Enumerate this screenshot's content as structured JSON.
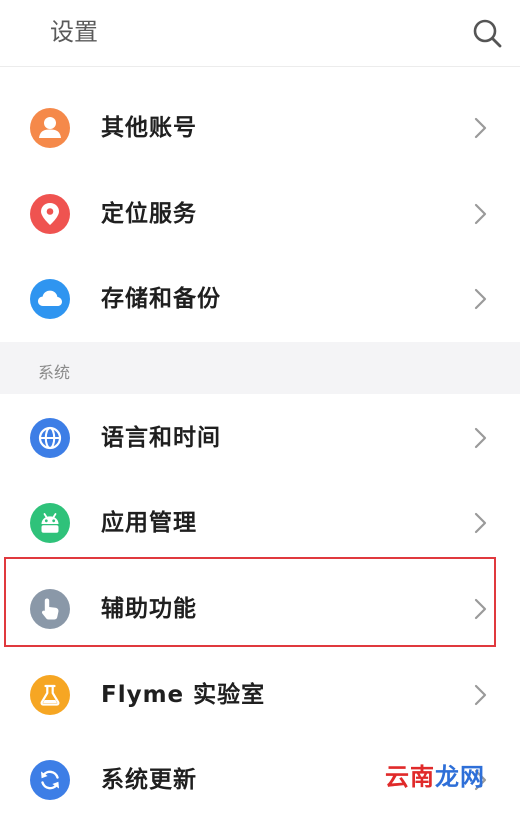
{
  "header": {
    "title": "设置",
    "search_icon": "search-icon"
  },
  "rows_top": [
    {
      "label": "其他账号",
      "icon": "person-icon",
      "color": "#f5894a"
    },
    {
      "label": "定位服务",
      "icon": "location-pin-icon",
      "color": "#ef5350"
    },
    {
      "label": "存储和备份",
      "icon": "cloud-icon",
      "color": "#2f95f0"
    }
  ],
  "section": {
    "title": "系统"
  },
  "rows_system": [
    {
      "label": "语言和时间",
      "icon": "globe-icon",
      "color": "#3d7ee6"
    },
    {
      "label": "应用管理",
      "icon": "android-icon",
      "color": "#2fc27a"
    },
    {
      "label": "辅助功能",
      "icon": "hand-pointer-icon",
      "color": "#8a98a8",
      "highlighted": true
    },
    {
      "label": "Flyme 实验室",
      "icon": "flask-icon",
      "color": "#f6a623"
    },
    {
      "label": "系统更新",
      "icon": "refresh-icon",
      "color": "#3d7ee6"
    }
  ],
  "watermark": {
    "part1": "云南",
    "part2": "龙网"
  },
  "colors": {
    "highlight_border": "#e0393e",
    "section_bg": "#f4f4f6"
  }
}
